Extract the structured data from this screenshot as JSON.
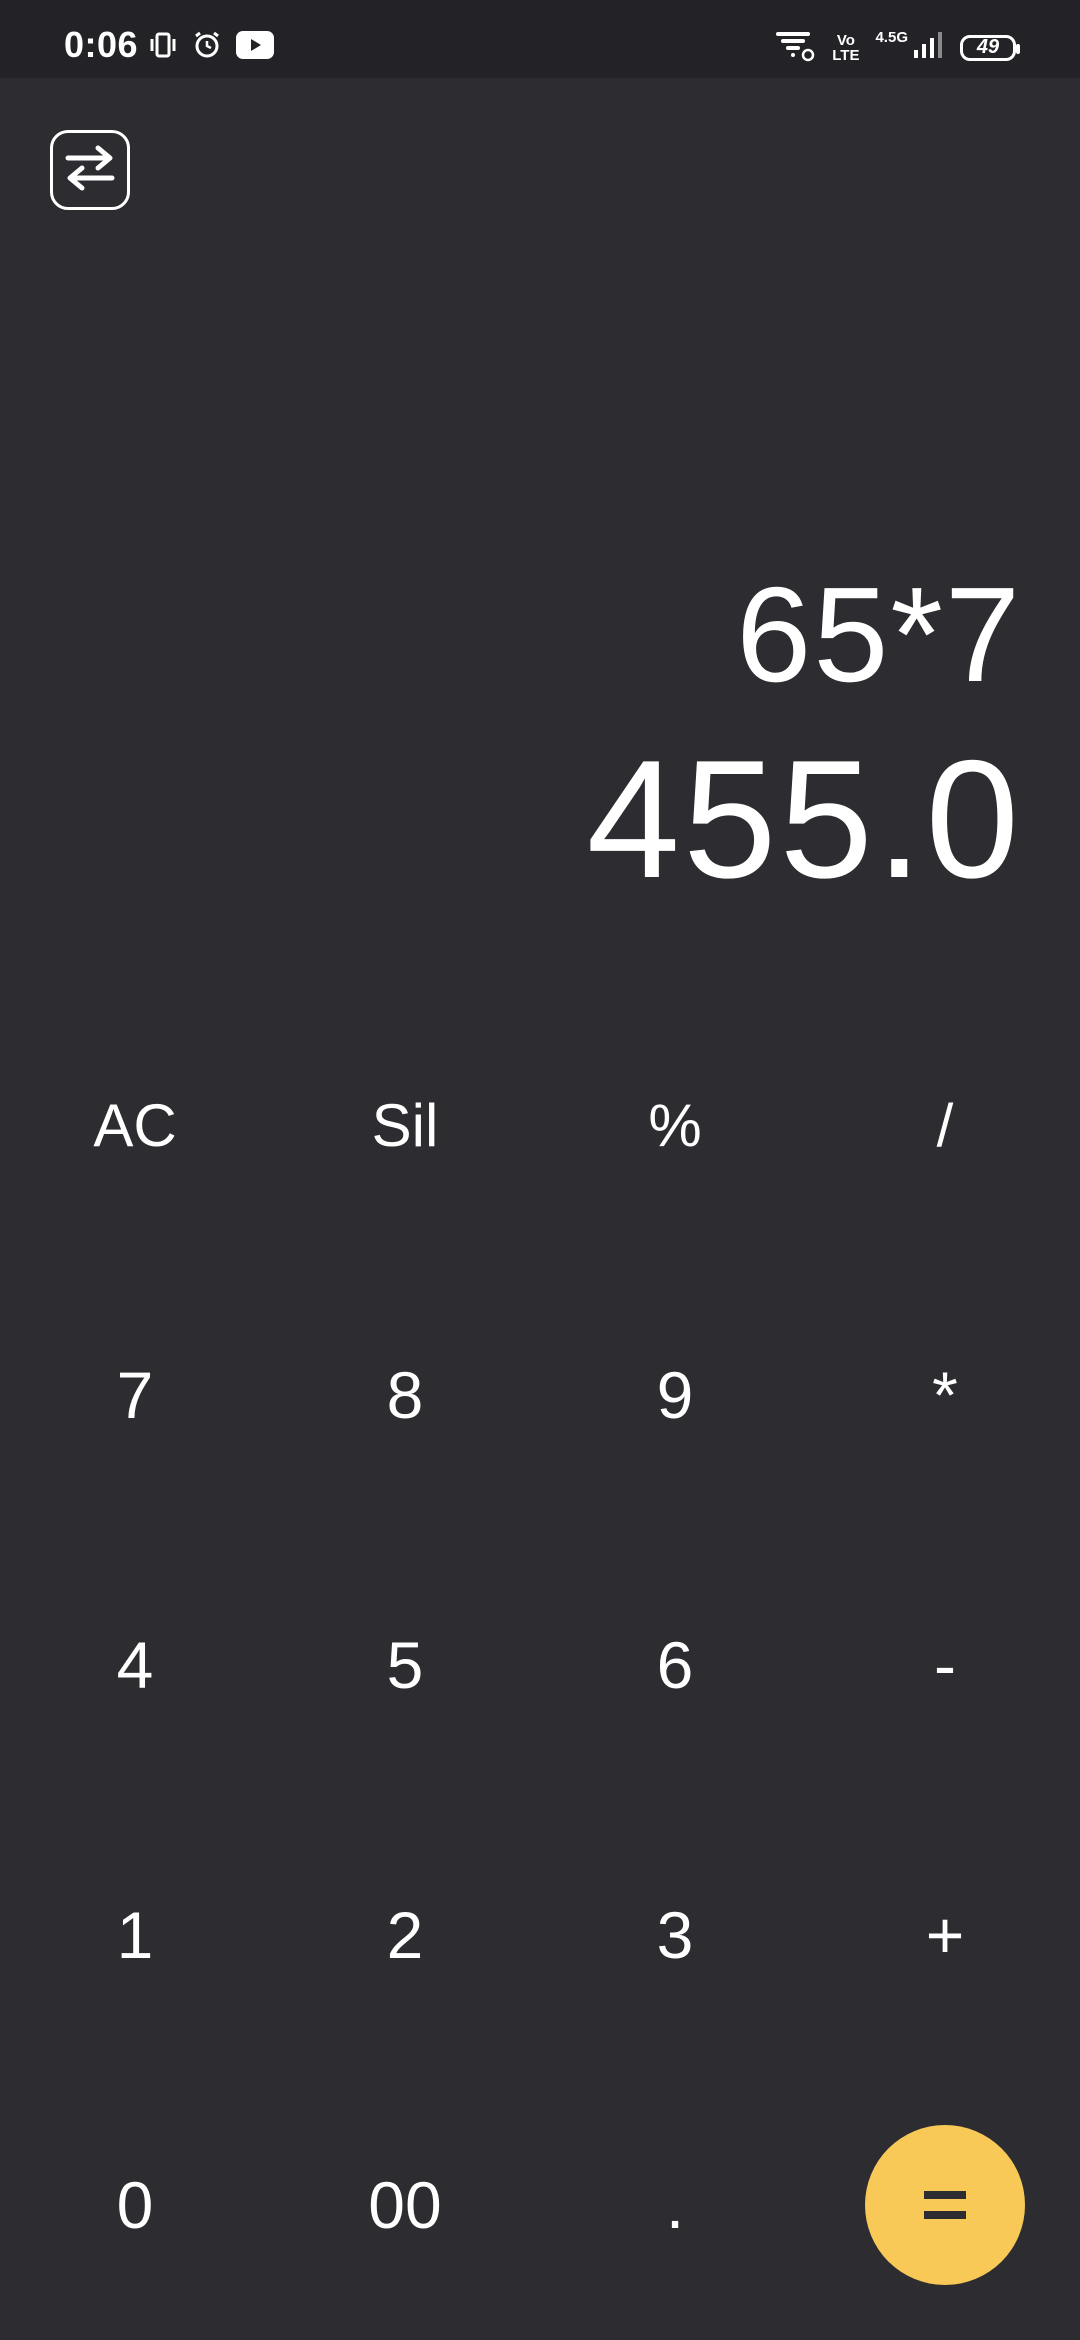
{
  "status_bar": {
    "time": "0:06",
    "network_label": "4.5G",
    "volte_line1": "Vo",
    "volte_line2": "LTE",
    "battery_level": "49"
  },
  "display": {
    "expression": "65*7",
    "result": "455.0"
  },
  "keypad": {
    "rows": [
      [
        "AC",
        "Sil",
        "%",
        "/"
      ],
      [
        "7",
        "8",
        "9",
        "*"
      ],
      [
        "4",
        "5",
        "6",
        "-"
      ],
      [
        "1",
        "2",
        "3",
        "+"
      ],
      [
        "0",
        "00",
        "."
      ]
    ]
  },
  "colors": {
    "background": "#2d2d31",
    "status_bar": "#232327",
    "equals_accent": "#f8c957"
  }
}
